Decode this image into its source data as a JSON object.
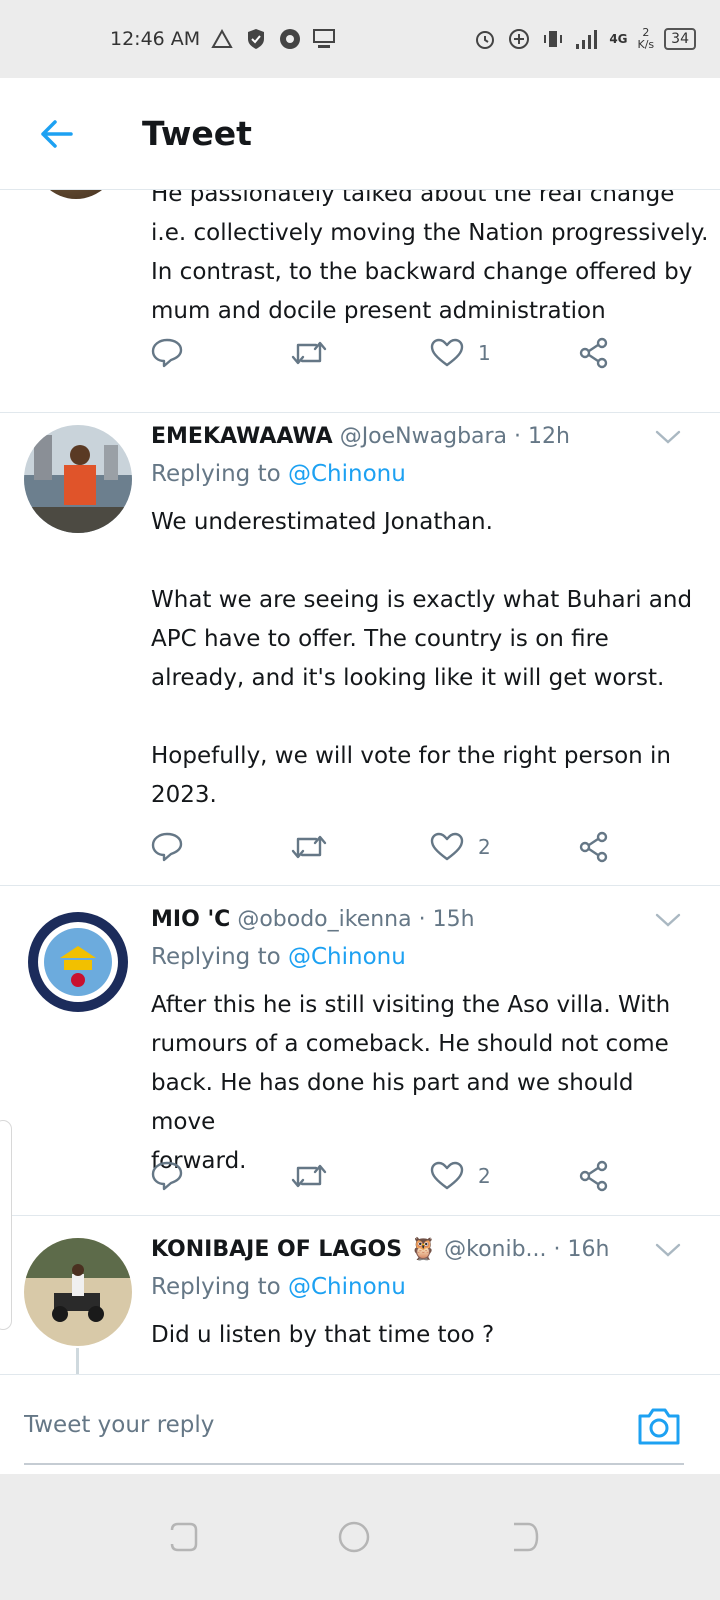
{
  "status_bar": {
    "time": "12:46 AM",
    "network": "4G",
    "net_speed_value": "2",
    "net_speed_unit": "K/s",
    "battery": "34"
  },
  "header": {
    "title": "Tweet"
  },
  "first_tweet": {
    "text": "He passionately talked about the real change\ni.e. collectively moving the Nation progressively.\nIn contrast, to the backward change offered by\nmum and docile present administration",
    "likes": "1"
  },
  "replies": [
    {
      "name": "EMEKAWAAWA",
      "handle": "@JoeNwagbara",
      "time": "· 12h",
      "replying_prefix": "Replying to",
      "replying_to": "@Chinonu",
      "text": "We underestimated Jonathan.\n\nWhat we are seeing is exactly what Buhari and\nAPC have to offer. The country is on fire\nalready, and it's looking like it will get worst.\n\nHopefully, we will vote for the right person in\n2023.",
      "likes": "2"
    },
    {
      "name": "MIO 'C",
      "handle": "@obodo_ikenna",
      "time": "· 15h",
      "replying_prefix": "Replying to",
      "replying_to": "@Chinonu",
      "text": "After this he is still visiting the Aso villa. With\nrumours of a comeback. He should not come\nback. He has done his part and we should move\nforward.",
      "likes": "2"
    },
    {
      "name": "KONIBAJE OF LAGOS 🦉",
      "handle": "@konib...",
      "time": "· 16h",
      "replying_prefix": "Replying to",
      "replying_to": "@Chinonu",
      "text": "Did u listen by that time too ?"
    }
  ],
  "reply_bar": {
    "placeholder": "Tweet your reply"
  },
  "colors": {
    "accent": "#1da1f2",
    "secondary_text": "#657786",
    "divider": "#e1e8ed"
  }
}
